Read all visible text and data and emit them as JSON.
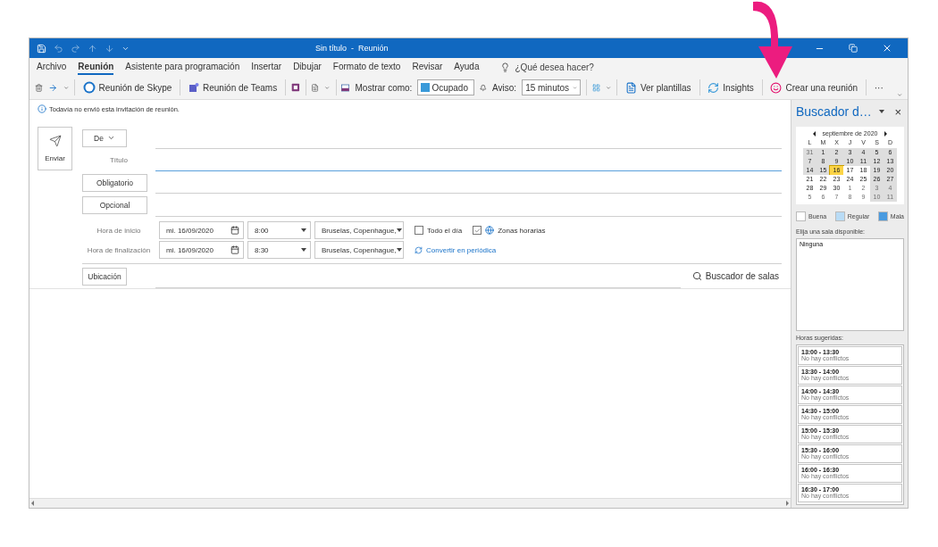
{
  "window": {
    "title": "Sin título  -  Reunión"
  },
  "menu_tabs": [
    {
      "label": "Archivo",
      "selected": false
    },
    {
      "label": "Reunión",
      "selected": true
    },
    {
      "label": "Asistente para programación",
      "selected": false
    },
    {
      "label": "Insertar",
      "selected": false
    },
    {
      "label": "Dibujar",
      "selected": false
    },
    {
      "label": "Formato de texto",
      "selected": false
    },
    {
      "label": "Revisar",
      "selected": false
    },
    {
      "label": "Ayuda",
      "selected": false
    }
  ],
  "search": {
    "placeholder": "¿Qué desea hacer?"
  },
  "ribbon": {
    "skype": "Reunión de Skype",
    "teams": "Reunión de Teams",
    "show_as_label": "Mostrar como:",
    "show_as_value": "Ocupado",
    "reminder_label": "Aviso:",
    "reminder_value": "15 minutos",
    "templates": "Ver plantillas",
    "insights": "Insights",
    "create": "Crear una reunión",
    "more": "···"
  },
  "info_bar": "Todavía no envió esta invitación de reunión.",
  "form": {
    "send": "Enviar",
    "from": "De",
    "title_label": "Título",
    "required": "Obligatorio",
    "optional": "Opcional",
    "times": [
      {
        "label": "Hora de inicio",
        "date": "mi. 16/09/2020",
        "time": "8:00",
        "zone": "Bruselas, Copenhague,"
      },
      {
        "label": "Hora de finalización",
        "date": "mi. 16/09/2020",
        "time": "8:30",
        "zone": "Bruselas, Copenhague,"
      }
    ],
    "all_day": {
      "label": "Todo el día",
      "checked": false
    },
    "time_zones": {
      "label": "Zonas horarias",
      "checked": true
    },
    "recurring": "Convertir en periódica",
    "location": "Ubicación",
    "room_finder": "Buscador de salas"
  },
  "room_pane": {
    "title": "Buscador d…",
    "close": "×",
    "month": "septiembre de 2020",
    "weekdays": [
      "L",
      "M",
      "X",
      "J",
      "V",
      "S",
      "D"
    ],
    "weeks": [
      [
        {
          "day": "31",
          "muted": true,
          "shaded": true,
          "selected": false
        },
        {
          "day": "1",
          "muted": false,
          "shaded": true,
          "selected": false
        },
        {
          "day": "2",
          "muted": false,
          "shaded": true,
          "selected": false
        },
        {
          "day": "3",
          "muted": false,
          "shaded": true,
          "selected": false
        },
        {
          "day": "4",
          "muted": false,
          "shaded": true,
          "selected": false
        },
        {
          "day": "5",
          "muted": false,
          "shaded": true,
          "selected": false
        },
        {
          "day": "6",
          "muted": false,
          "shaded": true,
          "selected": false
        }
      ],
      [
        {
          "day": "7",
          "muted": false,
          "shaded": true,
          "selected": false
        },
        {
          "day": "8",
          "muted": false,
          "shaded": true,
          "selected": false
        },
        {
          "day": "9",
          "muted": false,
          "shaded": true,
          "selected": false
        },
        {
          "day": "10",
          "muted": false,
          "shaded": true,
          "selected": false
        },
        {
          "day": "11",
          "muted": false,
          "shaded": true,
          "selected": false
        },
        {
          "day": "12",
          "muted": false,
          "shaded": true,
          "selected": false
        },
        {
          "day": "13",
          "muted": false,
          "shaded": true,
          "selected": false
        }
      ],
      [
        {
          "day": "14",
          "muted": false,
          "shaded": true,
          "selected": false
        },
        {
          "day": "15",
          "muted": false,
          "shaded": true,
          "selected": false
        },
        {
          "day": "16",
          "muted": false,
          "shaded": false,
          "selected": true
        },
        {
          "day": "17",
          "muted": false,
          "shaded": false,
          "selected": false
        },
        {
          "day": "18",
          "muted": false,
          "shaded": false,
          "selected": false
        },
        {
          "day": "19",
          "muted": false,
          "shaded": true,
          "selected": false
        },
        {
          "day": "20",
          "muted": false,
          "shaded": true,
          "selected": false
        }
      ],
      [
        {
          "day": "21",
          "muted": false,
          "shaded": false,
          "selected": false
        },
        {
          "day": "22",
          "muted": false,
          "shaded": false,
          "selected": false
        },
        {
          "day": "23",
          "muted": false,
          "shaded": false,
          "selected": false
        },
        {
          "day": "24",
          "muted": false,
          "shaded": false,
          "selected": false
        },
        {
          "day": "25",
          "muted": false,
          "shaded": false,
          "selected": false
        },
        {
          "day": "26",
          "muted": false,
          "shaded": true,
          "selected": false
        },
        {
          "day": "27",
          "muted": false,
          "shaded": true,
          "selected": false
        }
      ],
      [
        {
          "day": "28",
          "muted": false,
          "shaded": false,
          "selected": false
        },
        {
          "day": "29",
          "muted": false,
          "shaded": false,
          "selected": false
        },
        {
          "day": "30",
          "muted": false,
          "shaded": false,
          "selected": false
        },
        {
          "day": "1",
          "muted": true,
          "shaded": false,
          "selected": false
        },
        {
          "day": "2",
          "muted": true,
          "shaded": false,
          "selected": false
        },
        {
          "day": "3",
          "muted": true,
          "shaded": true,
          "selected": false
        },
        {
          "day": "4",
          "muted": true,
          "shaded": true,
          "selected": false
        }
      ],
      [
        {
          "day": "5",
          "muted": true,
          "shaded": false,
          "selected": false
        },
        {
          "day": "6",
          "muted": true,
          "shaded": false,
          "selected": false
        },
        {
          "day": "7",
          "muted": true,
          "shaded": false,
          "selected": false
        },
        {
          "day": "8",
          "muted": true,
          "shaded": false,
          "selected": false
        },
        {
          "day": "9",
          "muted": true,
          "shaded": false,
          "selected": false
        },
        {
          "day": "10",
          "muted": true,
          "shaded": true,
          "selected": false
        },
        {
          "day": "11",
          "muted": true,
          "shaded": true,
          "selected": false
        }
      ]
    ],
    "legend": [
      {
        "label": "Buena",
        "color": "#ffffff"
      },
      {
        "label": "Regular",
        "color": "#b9dcf6"
      },
      {
        "label": "Mala",
        "color": "#4a9be0"
      }
    ],
    "room_label": "Elija una sala disponible:",
    "rooms": [
      "Ninguna"
    ],
    "suggest_label": "Horas sugeridas:",
    "suggestions": [
      {
        "time": "13:00 - 13:30",
        "status": "No hay conflictos"
      },
      {
        "time": "13:30 - 14:00",
        "status": "No hay conflictos"
      },
      {
        "time": "14:00 - 14:30",
        "status": "No hay conflictos"
      },
      {
        "time": "14:30 - 15:00",
        "status": "No hay conflictos"
      },
      {
        "time": "15:00 - 15:30",
        "status": "No hay conflictos"
      },
      {
        "time": "15:30 - 16:00",
        "status": "No hay conflictos"
      },
      {
        "time": "16:00 - 16:30",
        "status": "No hay conflictos"
      },
      {
        "time": "16:30 - 17:00",
        "status": "No hay conflictos"
      }
    ]
  }
}
